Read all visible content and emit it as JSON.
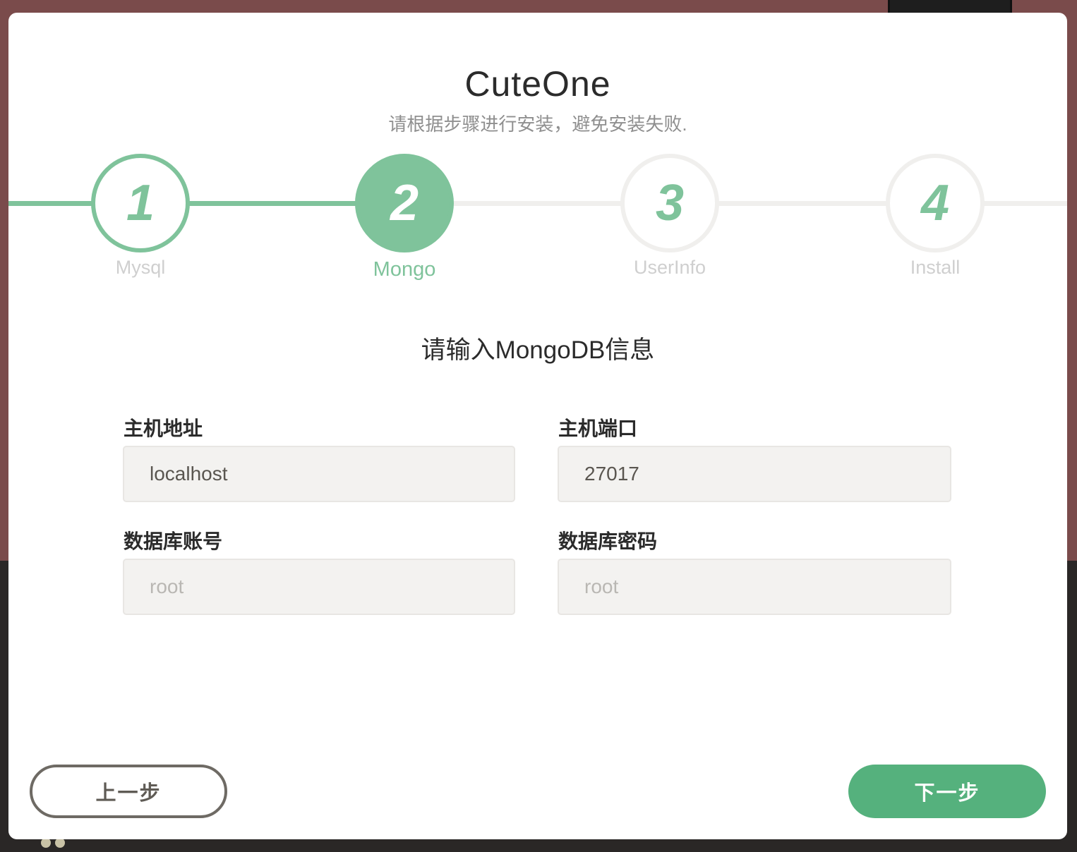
{
  "header": {
    "title": "CuteOne",
    "subtitle": "请根据步骤进行安装，避免安装失败."
  },
  "steps": [
    {
      "number": "1",
      "label": "Mysql",
      "state": "done"
    },
    {
      "number": "2",
      "label": "Mongo",
      "state": "active"
    },
    {
      "number": "3",
      "label": "UserInfo",
      "state": "todo"
    },
    {
      "number": "4",
      "label": "Install",
      "state": "todo"
    }
  ],
  "form": {
    "title": "请输入MongoDB信息",
    "host": {
      "label": "主机地址",
      "value": "localhost",
      "placeholder": ""
    },
    "port": {
      "label": "主机端口",
      "value": "27017",
      "placeholder": ""
    },
    "user": {
      "label": "数据库账号",
      "value": "",
      "placeholder": "root"
    },
    "password": {
      "label": "数据库密码",
      "value": "",
      "placeholder": "root"
    }
  },
  "buttons": {
    "prev_label": "上一步",
    "next_label": "下一步"
  },
  "colors": {
    "accent": "#7fc39b",
    "primary_button": "#55b17d",
    "inactive": "#f0efed"
  }
}
